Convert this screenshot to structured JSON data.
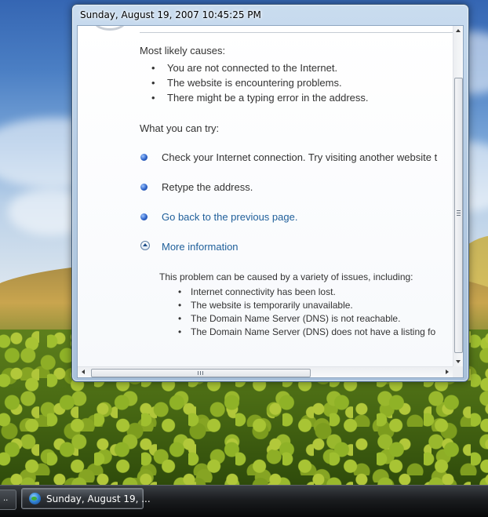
{
  "window": {
    "title": "Sunday, August 19, 2007 10:45:25 PM"
  },
  "error_page": {
    "causes_heading": "Most likely causes:",
    "causes": [
      "You are not connected to the Internet.",
      "The website is encountering problems.",
      "There might be a typing error in the address."
    ],
    "try_heading": "What you can try:",
    "try_items": [
      "Check your Internet connection. Try visiting another website t",
      "Retype the address.",
      "Go back to the previous page."
    ],
    "more_info_label": "More information",
    "info_intro": "This problem can be caused by a variety of issues, including:",
    "info_items": [
      "Internet connectivity has been lost.",
      "The website is temporarily unavailable.",
      "The Domain Name Server (DNS) is not reachable.",
      "The Domain Name Server (DNS) does not have a listing fo"
    ]
  },
  "scrollbars": {
    "horizontal_grip": "|||",
    "vertical_grip": "≡"
  },
  "taskbar": {
    "left_button": "..",
    "active_task": "Sunday, August 19, ...",
    "active_task_icon": "globe-icon"
  },
  "colors": {
    "link": "#1f5f9a",
    "bullet": "#2d63c8",
    "text": "#333333"
  }
}
